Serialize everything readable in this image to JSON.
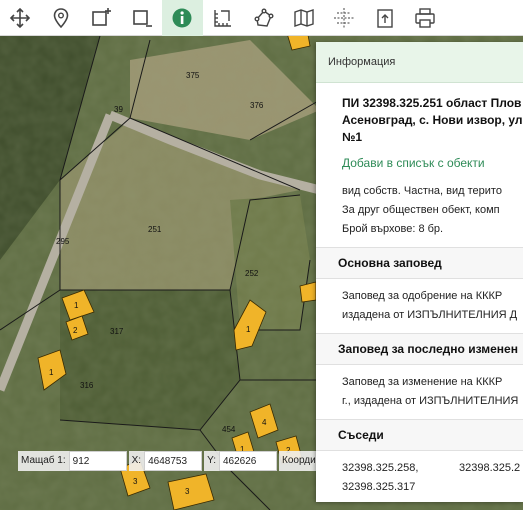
{
  "toolbar": {
    "tools": [
      "move-icon",
      "pin-icon",
      "add-area-icon",
      "remove-area-icon",
      "info-icon",
      "measure-icon",
      "polygon-icon",
      "layers-map-icon",
      "crosshair-icon",
      "export-icon",
      "print-icon"
    ]
  },
  "map": {
    "parcels": [
      "375",
      "376",
      "39",
      "251",
      "295",
      "252",
      "317",
      "316",
      "454",
      "1",
      "2",
      "1",
      "1",
      "1",
      "3",
      "4",
      "2",
      "3",
      "1",
      "6",
      "2"
    ]
  },
  "coords": {
    "scale_label": "Мащаб 1:",
    "scale_value": "912",
    "x_label": "X:",
    "x_value": "4648753",
    "y_label": "Y:",
    "y_value": "462626",
    "coord_label": "Координат"
  },
  "panel": {
    "header": "Информация",
    "title_line1": "ПИ 32398.325.251 област Плов",
    "title_line2": "Асеновград, с. Нови извор, ул.",
    "title_line3": "№1",
    "add_link": "Добави в списък с обекти",
    "props": [
      "вид собств. Частна, вид терито",
      "За друг обществен обект, комп",
      "Брой върхове: 8 бр."
    ],
    "order_heading": "Основна заповед",
    "order_text": [
      "Заповед за одобрение на КККР",
      "издадена от ИЗПЪЛНИТЕЛНИЯ Д"
    ],
    "last_change_heading": "Заповед за последно изменен",
    "last_change_text": [
      "Заповед за изменение на КККР",
      "г., издадена от ИЗПЪЛНИТЕЛНИЯ"
    ],
    "neighbors_heading": "Съседи",
    "neighbors": [
      "32398.325.258,",
      "32398.325.2",
      "32398.325.317"
    ]
  },
  "colors": {
    "accent": "#2e8b57",
    "header_bg": "#e8f5e9",
    "building": "#f0b429"
  }
}
